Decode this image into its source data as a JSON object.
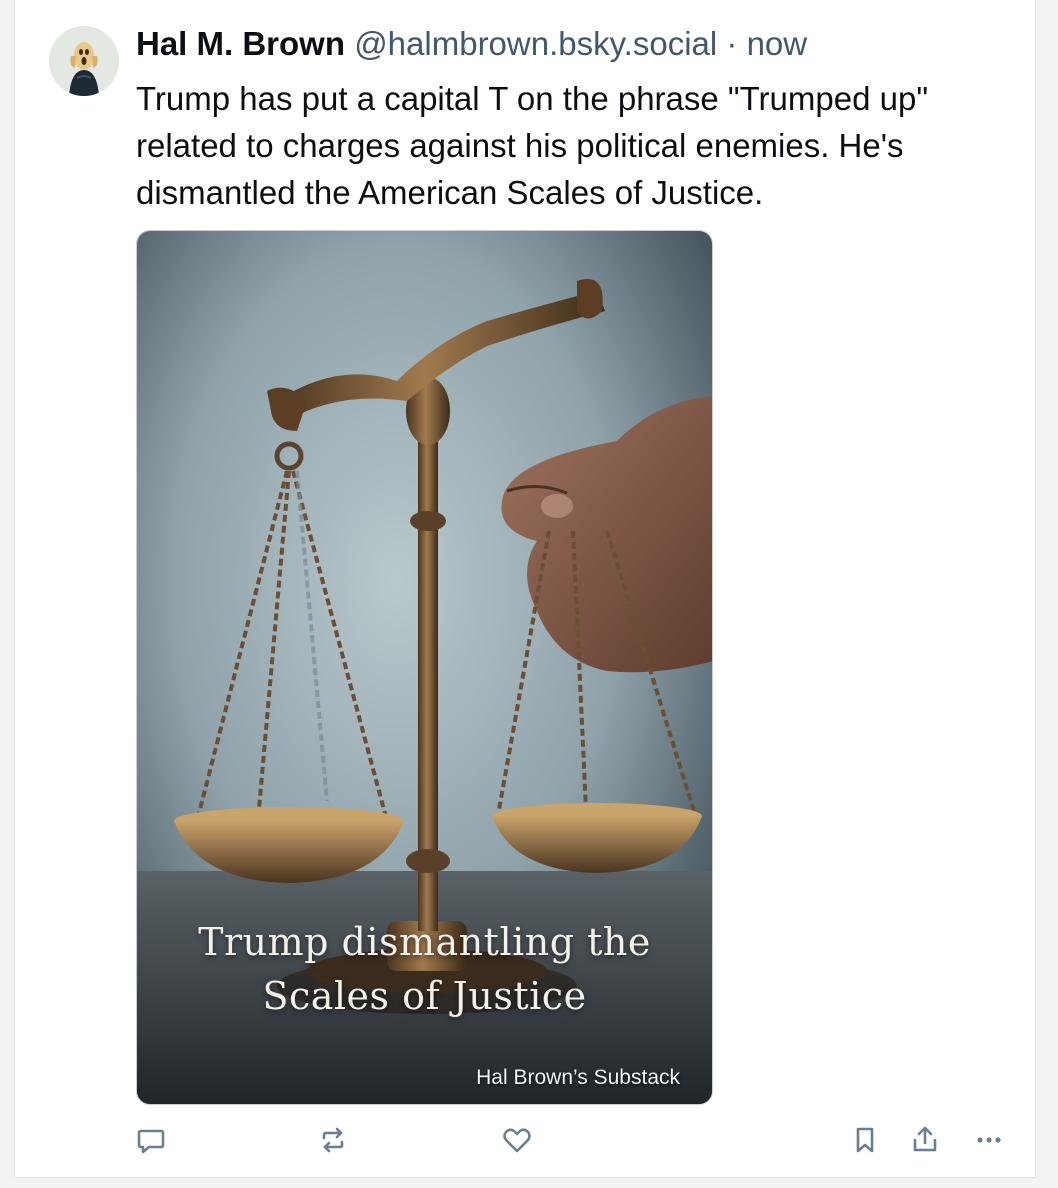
{
  "post": {
    "author": {
      "display_name": "Hal M. Brown",
      "handle": "@halmbrown.bsky.social",
      "avatar_icon": "scream-painting-avatar"
    },
    "separator": "·",
    "timestamp": "now",
    "text": "Trump has put a capital T on the phrase \"Trumped up\" related to charges against his political enemies. He's dismantled the American Scales of Justice.",
    "image": {
      "description_icon": "scales-of-justice-image",
      "overlay_title_line1": "Trump dismantling the",
      "overlay_title_line2": "Scales of Justice",
      "watermark": "Hal Brown’s Substack"
    },
    "actions": {
      "reply_icon": "reply-icon",
      "repost_icon": "repost-icon",
      "like_icon": "heart-icon",
      "bookmark_icon": "bookmark-icon",
      "share_icon": "share-icon",
      "more_icon": "more-icon"
    }
  },
  "colors": {
    "text_primary": "#0b0f14",
    "text_secondary": "#42576c",
    "icon": "#6b7f93",
    "border": "#e3e6ea"
  }
}
